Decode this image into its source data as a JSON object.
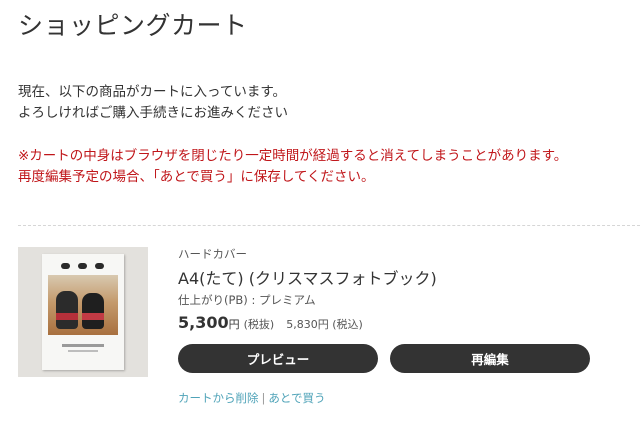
{
  "page": {
    "title": "ショッピングカート"
  },
  "intro": {
    "line1": "現在、以下の商品がカートに入っています。",
    "line2": "よろしければご購入手続きにお進みください"
  },
  "warning": {
    "line1": "※カートの中身はブラウザを閉じたり一定時間が経過すると消えてしまうことがあります。",
    "line2": "再度編集予定の場合、「あとで買う」に保存してください。"
  },
  "item": {
    "cover_type": "ハードカバー",
    "name": "A4(たて) (クリスマスフォトブック)",
    "finish": "仕上がり(PB) : プレミアム",
    "price_value": "5,300",
    "price_unit": "円",
    "tax_excluded_label": "(税抜)",
    "price_tax_included": "5,830円 (税込)",
    "buttons": {
      "preview": "プレビュー",
      "edit": "再編集"
    },
    "links": {
      "delete": "カートから削除",
      "separator": "|",
      "later": "あとで買う"
    }
  },
  "colors": {
    "warning_text": "#c0161a",
    "button_bg": "#333333",
    "link_text": "#4fa3b8"
  }
}
